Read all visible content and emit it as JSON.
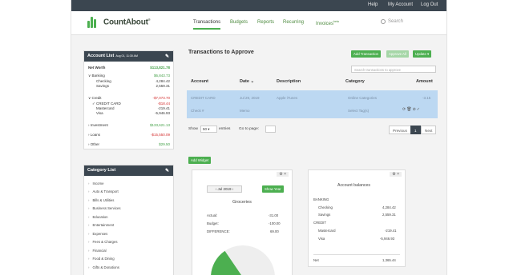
{
  "topbar": {
    "help": "Help",
    "my_account": "My Account",
    "logout": "Log Out"
  },
  "brand": {
    "name": "CountAbout",
    "trademark": "®"
  },
  "nav": {
    "transactions": "Transactions",
    "budgets": "Budgets",
    "reports": "Reports",
    "recurring": "Recurring",
    "invoices": "Invoices",
    "invoices_badge": "beta",
    "search": "Search"
  },
  "account_list": {
    "title": "Account List",
    "updated": "Aug 01, 11:30 AM",
    "net_worth_label": "Net Worth",
    "net_worth": "$113,821.78",
    "rows": [
      {
        "label": "Banking",
        "value": "$6,843.73",
        "cls": "green"
      },
      {
        "label": "Checking",
        "value": "4,284.42",
        "cls": ""
      },
      {
        "label": "Savings",
        "value": "2,559.31",
        "cls": ""
      },
      {
        "label": "Credit",
        "value": "-$7,073.70",
        "cls": "red"
      },
      {
        "label": "CREDIT CARD",
        "value": "-$18.44",
        "cls": "red"
      },
      {
        "label": "Mastercard",
        "value": "-219.41",
        "cls": ""
      },
      {
        "label": "Visa",
        "value": "-5,946.93",
        "cls": ""
      },
      {
        "label": "Investment",
        "value": "$133,621.13",
        "cls": "green"
      },
      {
        "label": "Loans",
        "value": "-$15,550.09",
        "cls": "red"
      },
      {
        "label": "Other",
        "value": "$29.50",
        "cls": "green"
      }
    ]
  },
  "category_list": {
    "title": "Category List",
    "items": [
      "Income",
      "Auto & Transport",
      "Bills & Utilities",
      "Business Services",
      "Education",
      "Entertainment",
      "Expenses",
      "Fees & Charges",
      "Financial",
      "Food & Dining",
      "Gifts & Donations"
    ]
  },
  "main": {
    "title": "Transactions to Approve",
    "add_transaction": "Add Transaction",
    "approve_all": "Approve All",
    "update": "Update ▾",
    "search_placeholder": "Search transactions to approve",
    "columns": [
      "Account",
      "Date",
      "Description",
      "Category",
      "Amount"
    ],
    "rows": [
      {
        "account": "CREDIT CARD",
        "date": "Jul 29, 2019",
        "description": "Apple iTunes",
        "category": "Online Categories",
        "amount": "-3.15"
      },
      {
        "account": "Check #",
        "date": "",
        "description": "Memo",
        "category": "Select Tag(s)",
        "amount": ""
      }
    ],
    "show_label": "Show",
    "show_value": "50",
    "entries_label": "entries",
    "goto_label": "Go to page:",
    "previous": "Previous",
    "page": "1",
    "next": "Next"
  },
  "add_widget": "Add Widget",
  "grocery_widget": {
    "period": "Jul 2019",
    "show_year": "Show Year",
    "title": "Groceries",
    "rows": [
      {
        "label": "Actual:",
        "value": "-31.00"
      },
      {
        "label": "Budget:",
        "value": "-100.00"
      },
      {
        "label": "DIFFERENCE:",
        "value": "69.00"
      }
    ],
    "gauge_fraction": 0.31,
    "colors": {
      "gauge_fill": "#4caf50",
      "gauge_track": "#eeeeee"
    }
  },
  "balances_widget": {
    "title": "Account balances",
    "banking_header": "BANKING",
    "banking": [
      {
        "label": "Checking",
        "value": "4,284.42"
      },
      {
        "label": "Savings",
        "value": "2,559.31"
      }
    ],
    "credit_header": "CREDIT",
    "credit": [
      {
        "label": "Mastercard",
        "value": "-219.41"
      },
      {
        "label": "Visa",
        "value": "-5,946.93"
      }
    ],
    "net_label": "Net",
    "net_value": "1,365.44"
  }
}
